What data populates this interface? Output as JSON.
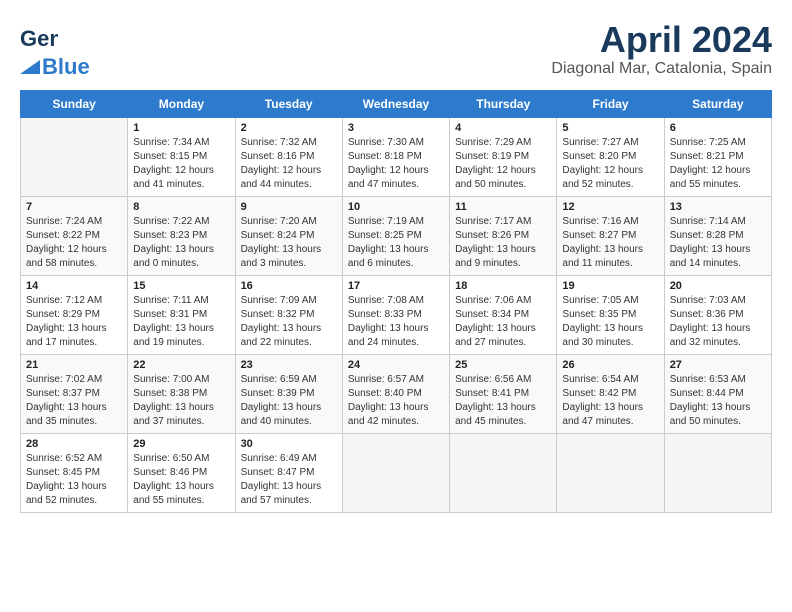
{
  "header": {
    "logo_line1": "General",
    "logo_line2": "Blue",
    "month": "April 2024",
    "location": "Diagonal Mar, Catalonia, Spain"
  },
  "days_of_week": [
    "Sunday",
    "Monday",
    "Tuesday",
    "Wednesday",
    "Thursday",
    "Friday",
    "Saturday"
  ],
  "weeks": [
    [
      {
        "day": "",
        "sunrise": "",
        "sunset": "",
        "daylight": ""
      },
      {
        "day": "1",
        "sunrise": "Sunrise: 7:34 AM",
        "sunset": "Sunset: 8:15 PM",
        "daylight": "Daylight: 12 hours and 41 minutes."
      },
      {
        "day": "2",
        "sunrise": "Sunrise: 7:32 AM",
        "sunset": "Sunset: 8:16 PM",
        "daylight": "Daylight: 12 hours and 44 minutes."
      },
      {
        "day": "3",
        "sunrise": "Sunrise: 7:30 AM",
        "sunset": "Sunset: 8:18 PM",
        "daylight": "Daylight: 12 hours and 47 minutes."
      },
      {
        "day": "4",
        "sunrise": "Sunrise: 7:29 AM",
        "sunset": "Sunset: 8:19 PM",
        "daylight": "Daylight: 12 hours and 50 minutes."
      },
      {
        "day": "5",
        "sunrise": "Sunrise: 7:27 AM",
        "sunset": "Sunset: 8:20 PM",
        "daylight": "Daylight: 12 hours and 52 minutes."
      },
      {
        "day": "6",
        "sunrise": "Sunrise: 7:25 AM",
        "sunset": "Sunset: 8:21 PM",
        "daylight": "Daylight: 12 hours and 55 minutes."
      }
    ],
    [
      {
        "day": "7",
        "sunrise": "Sunrise: 7:24 AM",
        "sunset": "Sunset: 8:22 PM",
        "daylight": "Daylight: 12 hours and 58 minutes."
      },
      {
        "day": "8",
        "sunrise": "Sunrise: 7:22 AM",
        "sunset": "Sunset: 8:23 PM",
        "daylight": "Daylight: 13 hours and 0 minutes."
      },
      {
        "day": "9",
        "sunrise": "Sunrise: 7:20 AM",
        "sunset": "Sunset: 8:24 PM",
        "daylight": "Daylight: 13 hours and 3 minutes."
      },
      {
        "day": "10",
        "sunrise": "Sunrise: 7:19 AM",
        "sunset": "Sunset: 8:25 PM",
        "daylight": "Daylight: 13 hours and 6 minutes."
      },
      {
        "day": "11",
        "sunrise": "Sunrise: 7:17 AM",
        "sunset": "Sunset: 8:26 PM",
        "daylight": "Daylight: 13 hours and 9 minutes."
      },
      {
        "day": "12",
        "sunrise": "Sunrise: 7:16 AM",
        "sunset": "Sunset: 8:27 PM",
        "daylight": "Daylight: 13 hours and 11 minutes."
      },
      {
        "day": "13",
        "sunrise": "Sunrise: 7:14 AM",
        "sunset": "Sunset: 8:28 PM",
        "daylight": "Daylight: 13 hours and 14 minutes."
      }
    ],
    [
      {
        "day": "14",
        "sunrise": "Sunrise: 7:12 AM",
        "sunset": "Sunset: 8:29 PM",
        "daylight": "Daylight: 13 hours and 17 minutes."
      },
      {
        "day": "15",
        "sunrise": "Sunrise: 7:11 AM",
        "sunset": "Sunset: 8:31 PM",
        "daylight": "Daylight: 13 hours and 19 minutes."
      },
      {
        "day": "16",
        "sunrise": "Sunrise: 7:09 AM",
        "sunset": "Sunset: 8:32 PM",
        "daylight": "Daylight: 13 hours and 22 minutes."
      },
      {
        "day": "17",
        "sunrise": "Sunrise: 7:08 AM",
        "sunset": "Sunset: 8:33 PM",
        "daylight": "Daylight: 13 hours and 24 minutes."
      },
      {
        "day": "18",
        "sunrise": "Sunrise: 7:06 AM",
        "sunset": "Sunset: 8:34 PM",
        "daylight": "Daylight: 13 hours and 27 minutes."
      },
      {
        "day": "19",
        "sunrise": "Sunrise: 7:05 AM",
        "sunset": "Sunset: 8:35 PM",
        "daylight": "Daylight: 13 hours and 30 minutes."
      },
      {
        "day": "20",
        "sunrise": "Sunrise: 7:03 AM",
        "sunset": "Sunset: 8:36 PM",
        "daylight": "Daylight: 13 hours and 32 minutes."
      }
    ],
    [
      {
        "day": "21",
        "sunrise": "Sunrise: 7:02 AM",
        "sunset": "Sunset: 8:37 PM",
        "daylight": "Daylight: 13 hours and 35 minutes."
      },
      {
        "day": "22",
        "sunrise": "Sunrise: 7:00 AM",
        "sunset": "Sunset: 8:38 PM",
        "daylight": "Daylight: 13 hours and 37 minutes."
      },
      {
        "day": "23",
        "sunrise": "Sunrise: 6:59 AM",
        "sunset": "Sunset: 8:39 PM",
        "daylight": "Daylight: 13 hours and 40 minutes."
      },
      {
        "day": "24",
        "sunrise": "Sunrise: 6:57 AM",
        "sunset": "Sunset: 8:40 PM",
        "daylight": "Daylight: 13 hours and 42 minutes."
      },
      {
        "day": "25",
        "sunrise": "Sunrise: 6:56 AM",
        "sunset": "Sunset: 8:41 PM",
        "daylight": "Daylight: 13 hours and 45 minutes."
      },
      {
        "day": "26",
        "sunrise": "Sunrise: 6:54 AM",
        "sunset": "Sunset: 8:42 PM",
        "daylight": "Daylight: 13 hours and 47 minutes."
      },
      {
        "day": "27",
        "sunrise": "Sunrise: 6:53 AM",
        "sunset": "Sunset: 8:44 PM",
        "daylight": "Daylight: 13 hours and 50 minutes."
      }
    ],
    [
      {
        "day": "28",
        "sunrise": "Sunrise: 6:52 AM",
        "sunset": "Sunset: 8:45 PM",
        "daylight": "Daylight: 13 hours and 52 minutes."
      },
      {
        "day": "29",
        "sunrise": "Sunrise: 6:50 AM",
        "sunset": "Sunset: 8:46 PM",
        "daylight": "Daylight: 13 hours and 55 minutes."
      },
      {
        "day": "30",
        "sunrise": "Sunrise: 6:49 AM",
        "sunset": "Sunset: 8:47 PM",
        "daylight": "Daylight: 13 hours and 57 minutes."
      },
      {
        "day": "",
        "sunrise": "",
        "sunset": "",
        "daylight": ""
      },
      {
        "day": "",
        "sunrise": "",
        "sunset": "",
        "daylight": ""
      },
      {
        "day": "",
        "sunrise": "",
        "sunset": "",
        "daylight": ""
      },
      {
        "day": "",
        "sunrise": "",
        "sunset": "",
        "daylight": ""
      }
    ]
  ]
}
